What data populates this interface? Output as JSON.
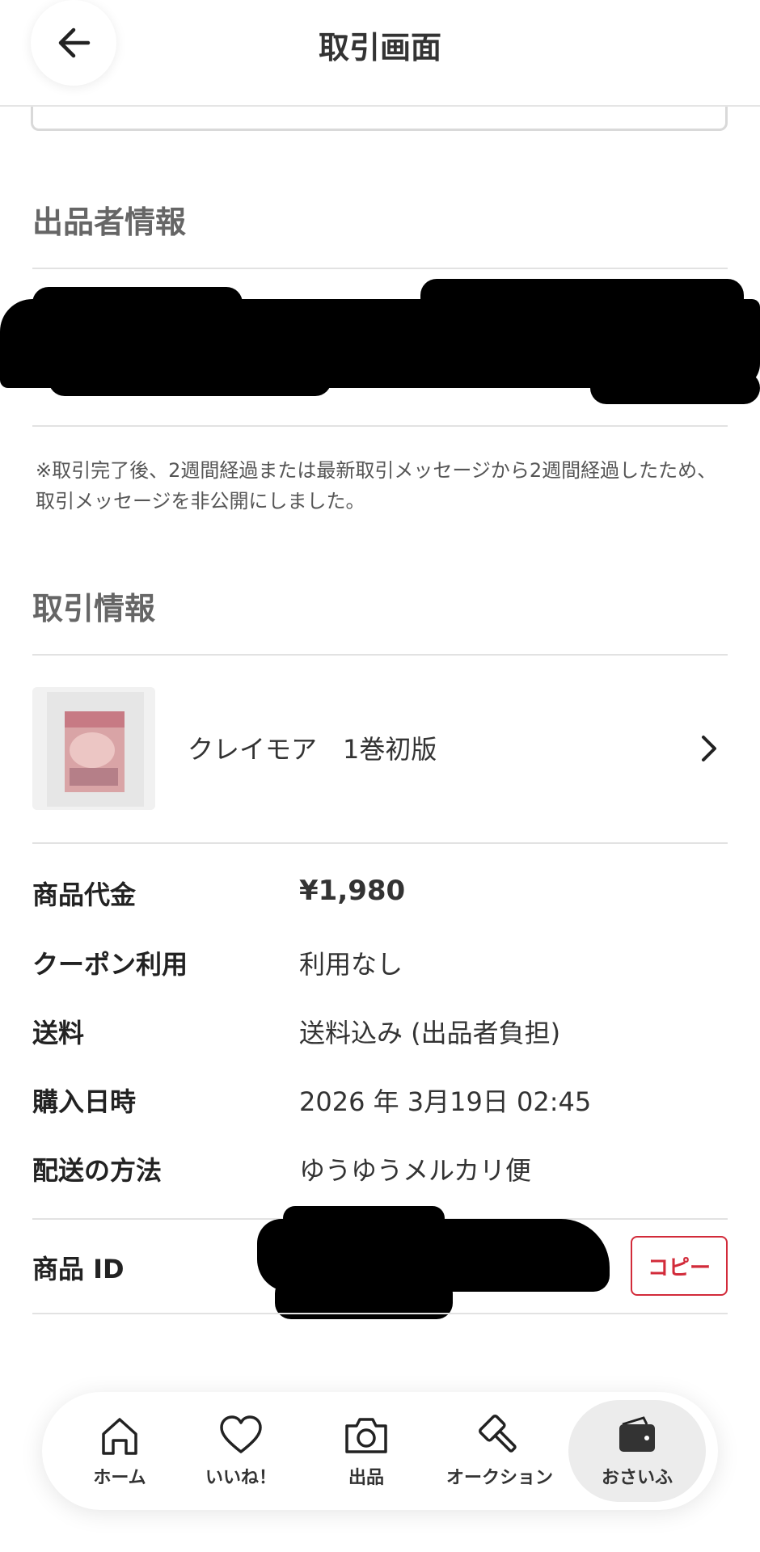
{
  "header": {
    "title": "取引画面"
  },
  "seller_section": {
    "title": "出品者情報"
  },
  "note": "※取引完了後、2週間経過または最新取引メッセージから2週間経過したため、取引メッセージを非公開にしました。",
  "transaction_section": {
    "title": "取引情報",
    "item_name": "クレイモア　1巻初版"
  },
  "details": {
    "price_label": "商品代金",
    "price_value": "¥1,980",
    "coupon_label": "クーポン利用",
    "coupon_value": "利用なし",
    "shipping_label": "送料",
    "shipping_value": "送料込み (出品者負担)",
    "purchase_label": "購入日時",
    "purchase_value": "2026 年 3月19日 02:45",
    "delivery_label": "配送の方法",
    "delivery_value": "ゆうゆうメルカリ便",
    "item_id_label": "商品 ID",
    "copy_label": "コピー"
  },
  "nav": {
    "items": [
      {
        "label": "ホーム",
        "icon": "home-icon"
      },
      {
        "label": "いいね！",
        "icon": "heart-icon"
      },
      {
        "label": "出品",
        "icon": "camera-icon"
      },
      {
        "label": "オークション",
        "icon": "gavel-icon"
      },
      {
        "label": "おさいふ",
        "icon": "wallet-icon"
      }
    ],
    "active_index": 4
  },
  "colors": {
    "accent": "#d22b3a",
    "section_title": "#666666",
    "divider": "#e2e2e2"
  }
}
